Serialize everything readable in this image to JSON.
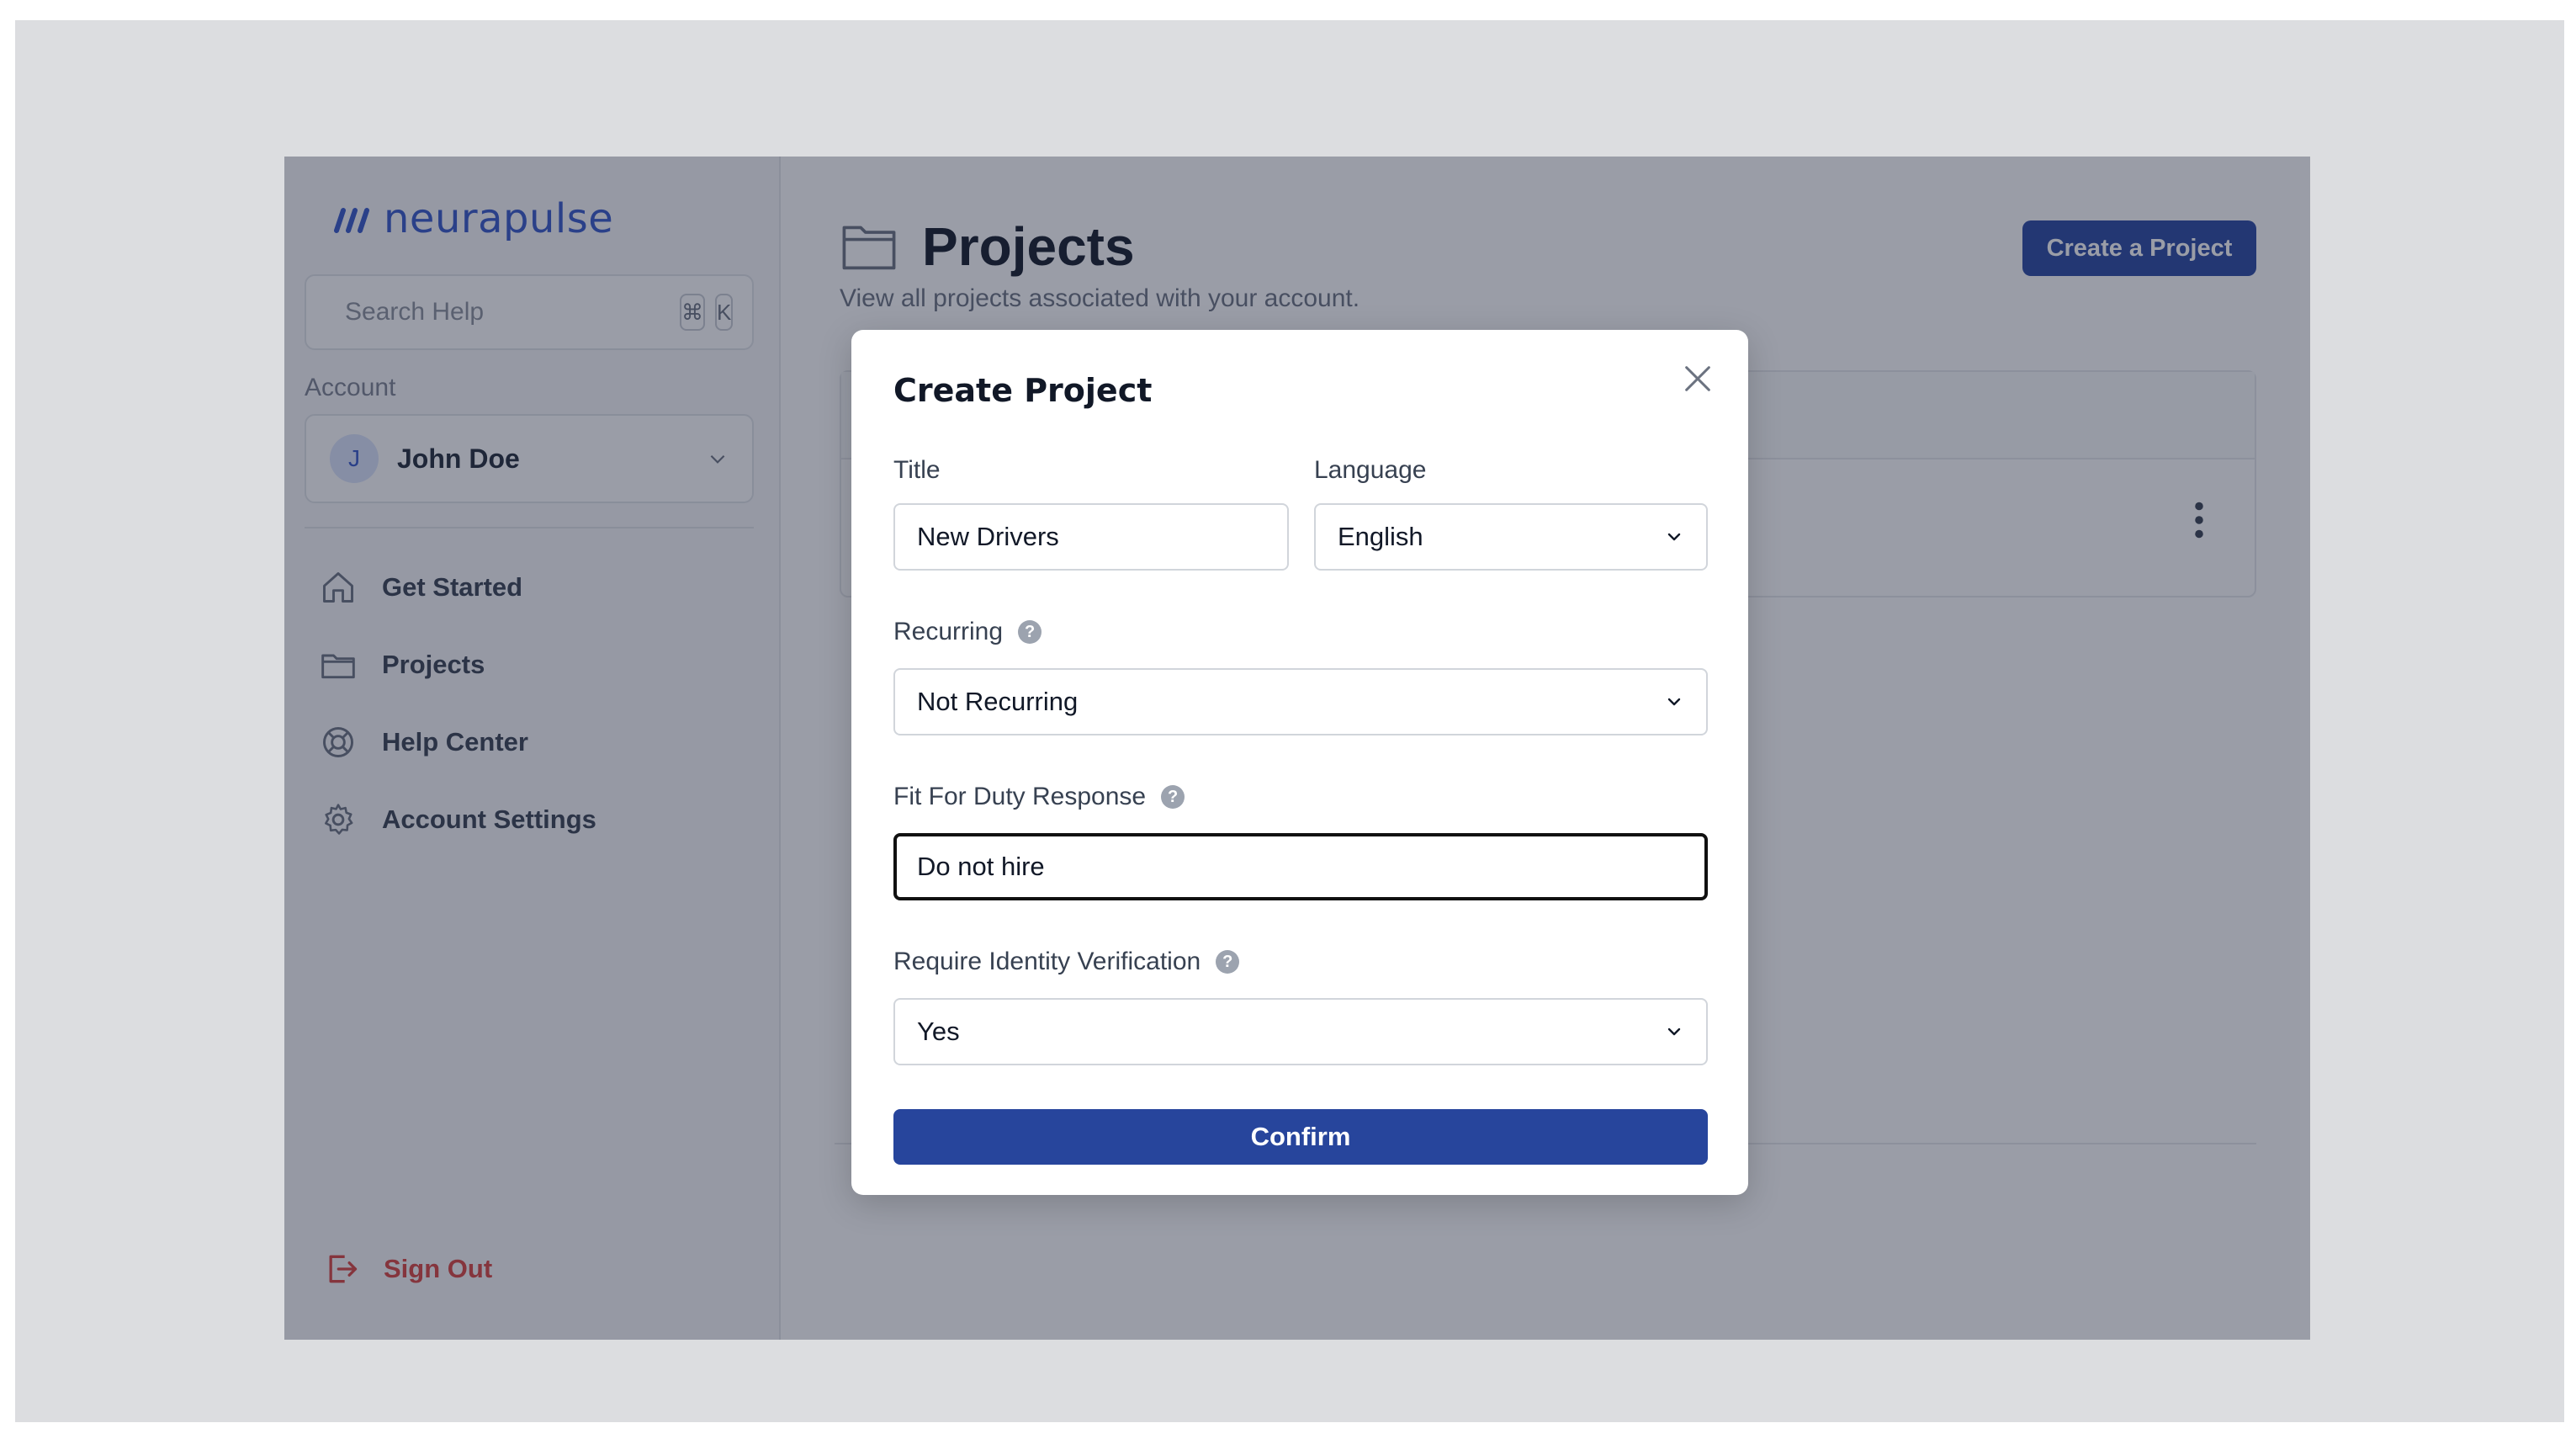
{
  "sidebar": {
    "logo_text": "neurapulse",
    "search": {
      "placeholder": "Search Help",
      "shortcut_keys": [
        "⌘",
        "K"
      ]
    },
    "account_label": "Account",
    "account": {
      "avatar_initial": "J",
      "name": "John Doe"
    },
    "nav": [
      {
        "label": "Get Started",
        "icon": "home-icon"
      },
      {
        "label": "Projects",
        "icon": "folder-icon"
      },
      {
        "label": "Help Center",
        "icon": "lifebuoy-icon"
      },
      {
        "label": "Account Settings",
        "icon": "gear-icon"
      }
    ],
    "sign_out_label": "Sign Out"
  },
  "main": {
    "title": "Projects",
    "subtitle": "View all projects associated with your account.",
    "create_button_label": "Create a Project"
  },
  "modal": {
    "title": "Create Project",
    "fields": {
      "title": {
        "label": "Title",
        "value": "New Drivers"
      },
      "language": {
        "label": "Language",
        "value": "English"
      },
      "recurring": {
        "label": "Recurring",
        "value": "Not Recurring"
      },
      "fit_for_duty": {
        "label": "Fit For Duty Response",
        "value": "Do not hire"
      },
      "identity": {
        "label": "Require Identity Verification",
        "value": "Yes"
      }
    },
    "confirm_label": "Confirm"
  },
  "colors": {
    "brand": "#3457c9",
    "primary_button": "#27459c",
    "danger": "#d9433f",
    "overlay": "rgba(30,38,60,0.45)"
  }
}
